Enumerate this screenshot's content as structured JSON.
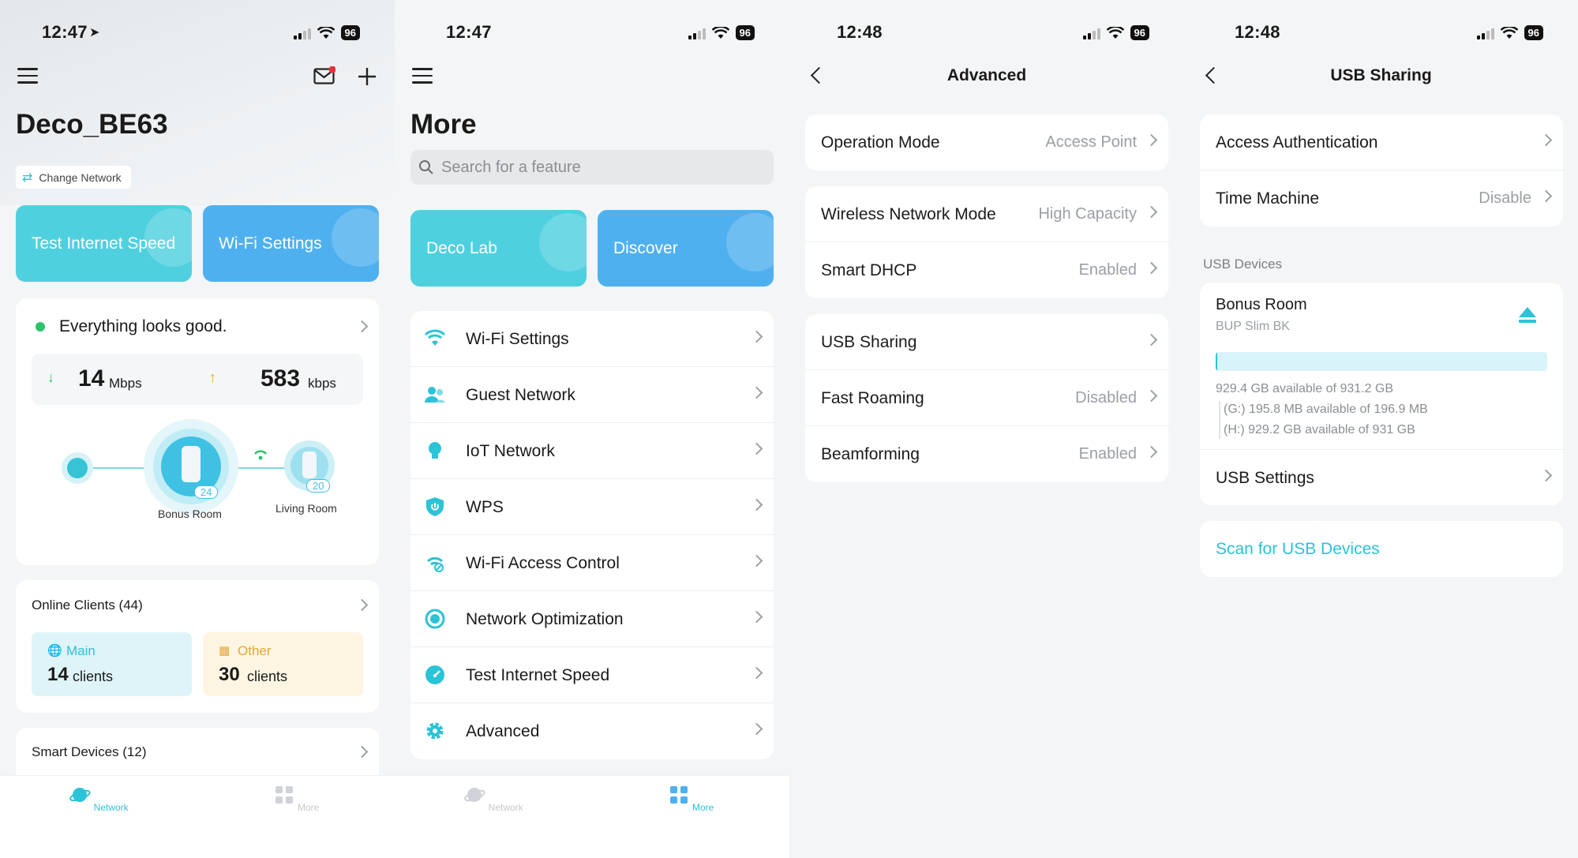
{
  "status": {
    "s1_time": "12:47",
    "s2_time": "12:47",
    "s3_time": "12:48",
    "s4_time": "12:48",
    "battery": "96"
  },
  "network": {
    "title": "Deco_BE63",
    "change_network": "Change Network",
    "tile_speed": "Test Internet Speed",
    "tile_wifi": "Wi-Fi Settings",
    "status_text": "Everything looks good.",
    "download_value": "14",
    "download_unit": "Mbps",
    "upload_value": "583",
    "upload_unit": "kbps",
    "main_node_label": "Bonus Room",
    "main_node_count": "24",
    "sat_node_label": "Living Room",
    "sat_node_count": "20",
    "online_clients": "Online Clients (44)",
    "main_label": "Main",
    "main_count": "14",
    "main_suffix": "clients",
    "other_label": "Other",
    "other_count": "30",
    "other_suffix": "clients",
    "smart_devices": "Smart Devices (12)"
  },
  "more": {
    "title": "More",
    "search_placeholder": "Search for a feature",
    "tile_lab": "Deco Lab",
    "tile_discover": "Discover",
    "items": [
      {
        "label": "Wi-Fi Settings"
      },
      {
        "label": "Guest Network"
      },
      {
        "label": "IoT Network"
      },
      {
        "label": "WPS"
      },
      {
        "label": "Wi-Fi Access Control"
      },
      {
        "label": "Network Optimization"
      },
      {
        "label": "Test Internet Speed"
      },
      {
        "label": "Advanced"
      }
    ]
  },
  "tabs": {
    "network": "Network",
    "more": "More"
  },
  "advanced": {
    "title": "Advanced",
    "rows": [
      {
        "label": "Operation Mode",
        "value": "Access Point"
      },
      {
        "label": "Wireless Network Mode",
        "value": "High Capacity"
      },
      {
        "label": "Smart DHCP",
        "value": "Enabled"
      },
      {
        "label": "USB Sharing",
        "value": ""
      },
      {
        "label": "Fast Roaming",
        "value": "Disabled"
      },
      {
        "label": "Beamforming",
        "value": "Enabled"
      }
    ]
  },
  "usb": {
    "title": "USB Sharing",
    "access_auth": "Access Authentication",
    "time_machine": "Time Machine",
    "time_machine_value": "Disable",
    "devices_header": "USB Devices",
    "device_name": "Bonus Room",
    "device_model": "BUP Slim BK",
    "usage_fraction": 0.0002,
    "total_avail": "929.4 GB available of 931.2 GB",
    "part_g": "(G:) 195.8 MB available of 196.9 MB",
    "part_h": "(H:) 929.2 GB available of 931 GB",
    "usb_settings": "USB Settings",
    "scan": "Scan for USB Devices"
  },
  "colors": {
    "accent": "#2bc3d7",
    "tile_teal": "#4fd0df",
    "tile_blue": "#4fb0ef",
    "green": "#2dc26b"
  }
}
